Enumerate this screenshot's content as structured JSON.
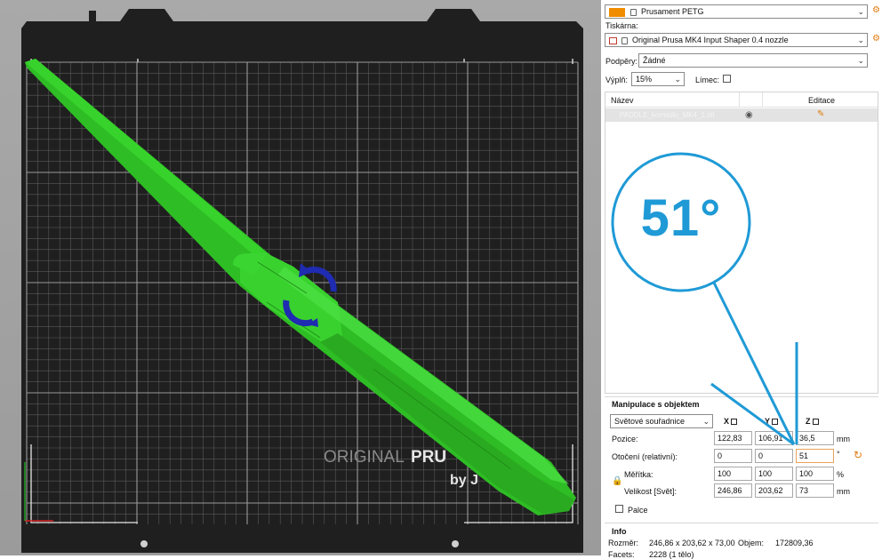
{
  "viewport": {
    "bed_logo_line1a": "ORIGINAL",
    "bed_logo_line1b": "PRU",
    "bed_logo_line2": "by J"
  },
  "panel": {
    "filament": {
      "name": "Prusament PETG",
      "swatch_color": "#f08c00"
    },
    "printer_label": "Tiskárna:",
    "printer": {
      "name": "Original Prusa MK4 Input Shaper 0.4 nozzle"
    },
    "supports": {
      "label": "Podpěry:",
      "value": "Žádné"
    },
    "infill": {
      "label": "Výplň:",
      "value": "15%"
    },
    "brim": {
      "label": "Límec:",
      "checked": false
    },
    "object_list": {
      "col_name": "Název",
      "col_edit": "Editace",
      "items": [
        {
          "name": "PADDLE_kormidlo_MK4_1.stl"
        }
      ]
    },
    "manipulation": {
      "title": "Manipulace s objektem",
      "coords_select": "Světové souřadnice",
      "axis_x": "X",
      "axis_y": "Y",
      "axis_z": "Z",
      "position_label": "Pozice:",
      "position": [
        "122,83",
        "106,91",
        "36,5"
      ],
      "position_unit": "mm",
      "rotation_label": "Otočení (relativní):",
      "rotation": [
        "0",
        "0",
        "51"
      ],
      "rotation_unit": "°",
      "scale_label": "Měřítka:",
      "scale": [
        "100",
        "100",
        "100"
      ],
      "scale_unit": "%",
      "size_label": "Velikost [Svět]:",
      "size": [
        "246,86",
        "203,62",
        "73"
      ],
      "size_unit": "mm",
      "inches_label": "Palce"
    },
    "info": {
      "title": "Info",
      "size_label": "Rozměr:",
      "size_value": "246,86 x 203,62 x 73,00",
      "volume_label": "Objem:",
      "volume_value": "172809,36",
      "facets_label": "Facets:",
      "facets_value": "2228 (1 tělo)"
    }
  },
  "annotation": {
    "text": "51°",
    "color": "#1f9ad6"
  }
}
